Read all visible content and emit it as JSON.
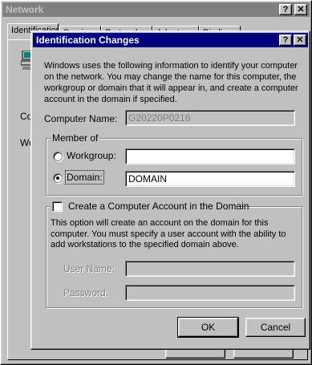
{
  "network_window": {
    "title": "Network",
    "help_glyph": "?",
    "close_glyph": "✕",
    "tabs": [
      "Identification",
      "Services",
      "Protocols",
      "Adapters",
      "Bindings"
    ],
    "label_computer": "Co",
    "label_workgroup": "Wo"
  },
  "dialog": {
    "title": "Identification Changes",
    "help_glyph": "?",
    "close_glyph": "✕",
    "description": "Windows uses the following information to identify your computer on the network.  You may change the name for this computer, the workgroup or domain that it will appear in, and create a computer account in the domain if specified.",
    "computer_name_label": "Computer Name:",
    "computer_name_value": "G20220P0216",
    "member_of_label": "Member of",
    "workgroup_label": "Workgroup:",
    "workgroup_value": "",
    "domain_label": "Domain:",
    "domain_value": "DOMAIN",
    "selected_membership": "domain",
    "create_account_label": "Create a Computer Account in the Domain",
    "create_account_checked": false,
    "create_account_description": "This option will create an account on the domain for this computer.  You must specify a user account with the ability to add workstations to the specified domain above.",
    "username_label": "User Name:",
    "username_value": "",
    "password_label": "Password:",
    "password_value": "",
    "ok_label": "OK",
    "cancel_label": "Cancel"
  }
}
